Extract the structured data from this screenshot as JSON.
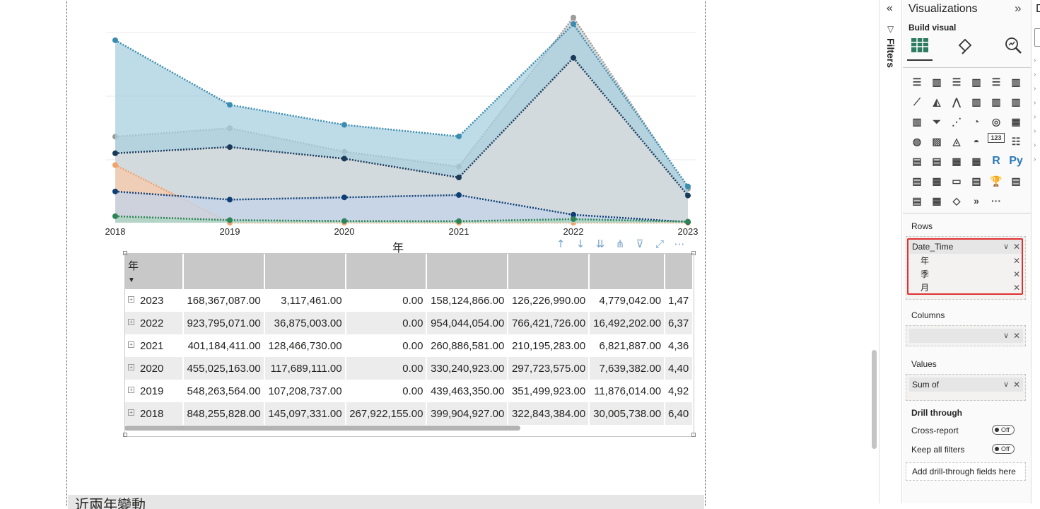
{
  "chart_data": {
    "type": "area",
    "x": [
      "2018",
      "2019",
      "2020",
      "2021",
      "2022",
      "2023"
    ],
    "xlabel": "年",
    "series": [
      {
        "color": "#3a8db0",
        "values": [
          848255828,
          548263564,
          455025163,
          401184411,
          923795071,
          168367087
        ]
      },
      {
        "color": "#1a3a5a",
        "values": [
          322843384,
          351499923,
          297723575,
          210195283,
          766421726,
          126226990
        ]
      },
      {
        "color": "#9c9c9c",
        "values": [
          399904927,
          439463350,
          330240923,
          260886581,
          954044054,
          158124866
        ]
      },
      {
        "color": "#0e3e74",
        "values": [
          145097331,
          107208737,
          117689111,
          128466730,
          36875003,
          3117461
        ]
      },
      {
        "color": "#2e8456",
        "values": [
          30005738,
          11876014,
          7639382,
          6821887,
          16492202,
          4779042
        ]
      },
      {
        "color": "#f3a26a",
        "values": [
          267922155,
          0,
          0,
          0,
          0,
          0
        ]
      }
    ]
  },
  "visual_header": {
    "icons": [
      "arrow-up-icon",
      "arrow-down-icon",
      "double-arrow-down-icon",
      "expand-hierarchy-icon",
      "filter-icon",
      "focus-mode-icon",
      "more-options-icon"
    ]
  },
  "matrix": {
    "row_header": "年",
    "rows": [
      {
        "year": "2023",
        "cells": [
          "168,367,087.00",
          "3,117,461.00",
          "0.00",
          "158,124,866.00",
          "126,226,990.00",
          "4,779,042.00",
          "1,47"
        ]
      },
      {
        "year": "2022",
        "cells": [
          "923,795,071.00",
          "36,875,003.00",
          "0.00",
          "954,044,054.00",
          "766,421,726.00",
          "16,492,202.00",
          "6,37"
        ]
      },
      {
        "year": "2021",
        "cells": [
          "401,184,411.00",
          "128,466,730.00",
          "0.00",
          "260,886,581.00",
          "210,195,283.00",
          "6,821,887.00",
          "4,36"
        ]
      },
      {
        "year": "2020",
        "cells": [
          "455,025,163.00",
          "117,689,111.00",
          "0.00",
          "330,240,923.00",
          "297,723,575.00",
          "7,639,382.00",
          "4,40"
        ]
      },
      {
        "year": "2019",
        "cells": [
          "548,263,564.00",
          "107,208,737.00",
          "0.00",
          "439,463,350.00",
          "351,499,923.00",
          "11,876,014.00",
          "4,92"
        ]
      },
      {
        "year": "2018",
        "cells": [
          "848,255,828.00",
          "145,097,331.00",
          "267,922,155.00",
          "399,904,927.00",
          "322,843,384.00",
          "30,005,738.00",
          "6,40"
        ]
      }
    ]
  },
  "next_visual_title": "近兩年變動",
  "filters_rail": {
    "label": "Filters"
  },
  "viz_pane": {
    "title": "Visualizations",
    "build_visual": "Build visual",
    "rows_label": "Rows",
    "rows_field": "Date_Time",
    "rows_subfields": [
      "年",
      "季",
      "月"
    ],
    "columns_label": "Columns",
    "values_label": "Values",
    "values_field": "Sum of",
    "drill_through_label": "Drill through",
    "cross_report_label": "Cross-report",
    "cross_report_state": "Off",
    "keep_filters_label": "Keep all filters",
    "keep_filters_state": "Off",
    "drill_add": "Add drill-through fields here",
    "gallery_extra": [
      "R",
      "Py",
      "123",
      "···"
    ]
  },
  "data_pane": {
    "title_letter": "D"
  }
}
